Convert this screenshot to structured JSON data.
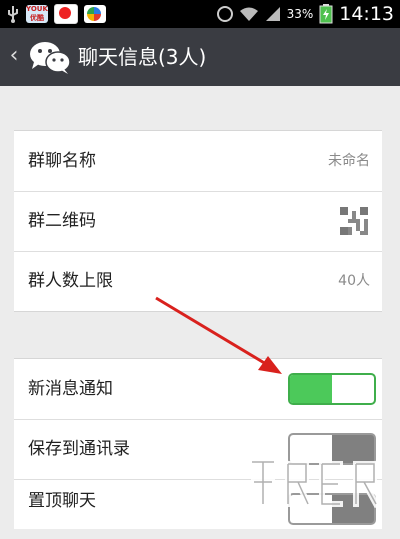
{
  "status_bar": {
    "battery": "33%",
    "time": "14:13",
    "app_icons": [
      {
        "name": "youku-icon",
        "text": "YOUKU\n优酷"
      },
      {
        "name": "sohu-icon",
        "text": ""
      },
      {
        "name": "qq-browser-icon",
        "text": ""
      }
    ]
  },
  "header": {
    "back_icon": "chevron-left-icon",
    "logo_icon": "wechat-icon",
    "title": "聊天信息(3人)"
  },
  "group_info": [
    {
      "label": "群聊名称",
      "value": "未命名"
    },
    {
      "label": "群二维码",
      "value_icon": "qr-code-icon"
    },
    {
      "label": "群人数上限",
      "value": "40人"
    }
  ],
  "settings": [
    {
      "label": "新消息通知",
      "toggle": "on"
    },
    {
      "label": "保存到通讯录",
      "toggle": "off"
    },
    {
      "label": "置顶聊天",
      "toggle": "off"
    }
  ],
  "colors": {
    "titlebar": "#3a3c42",
    "toggle_on": "#4cc95a",
    "toggle_off": "#808080",
    "arrow": "#d9211d"
  }
}
